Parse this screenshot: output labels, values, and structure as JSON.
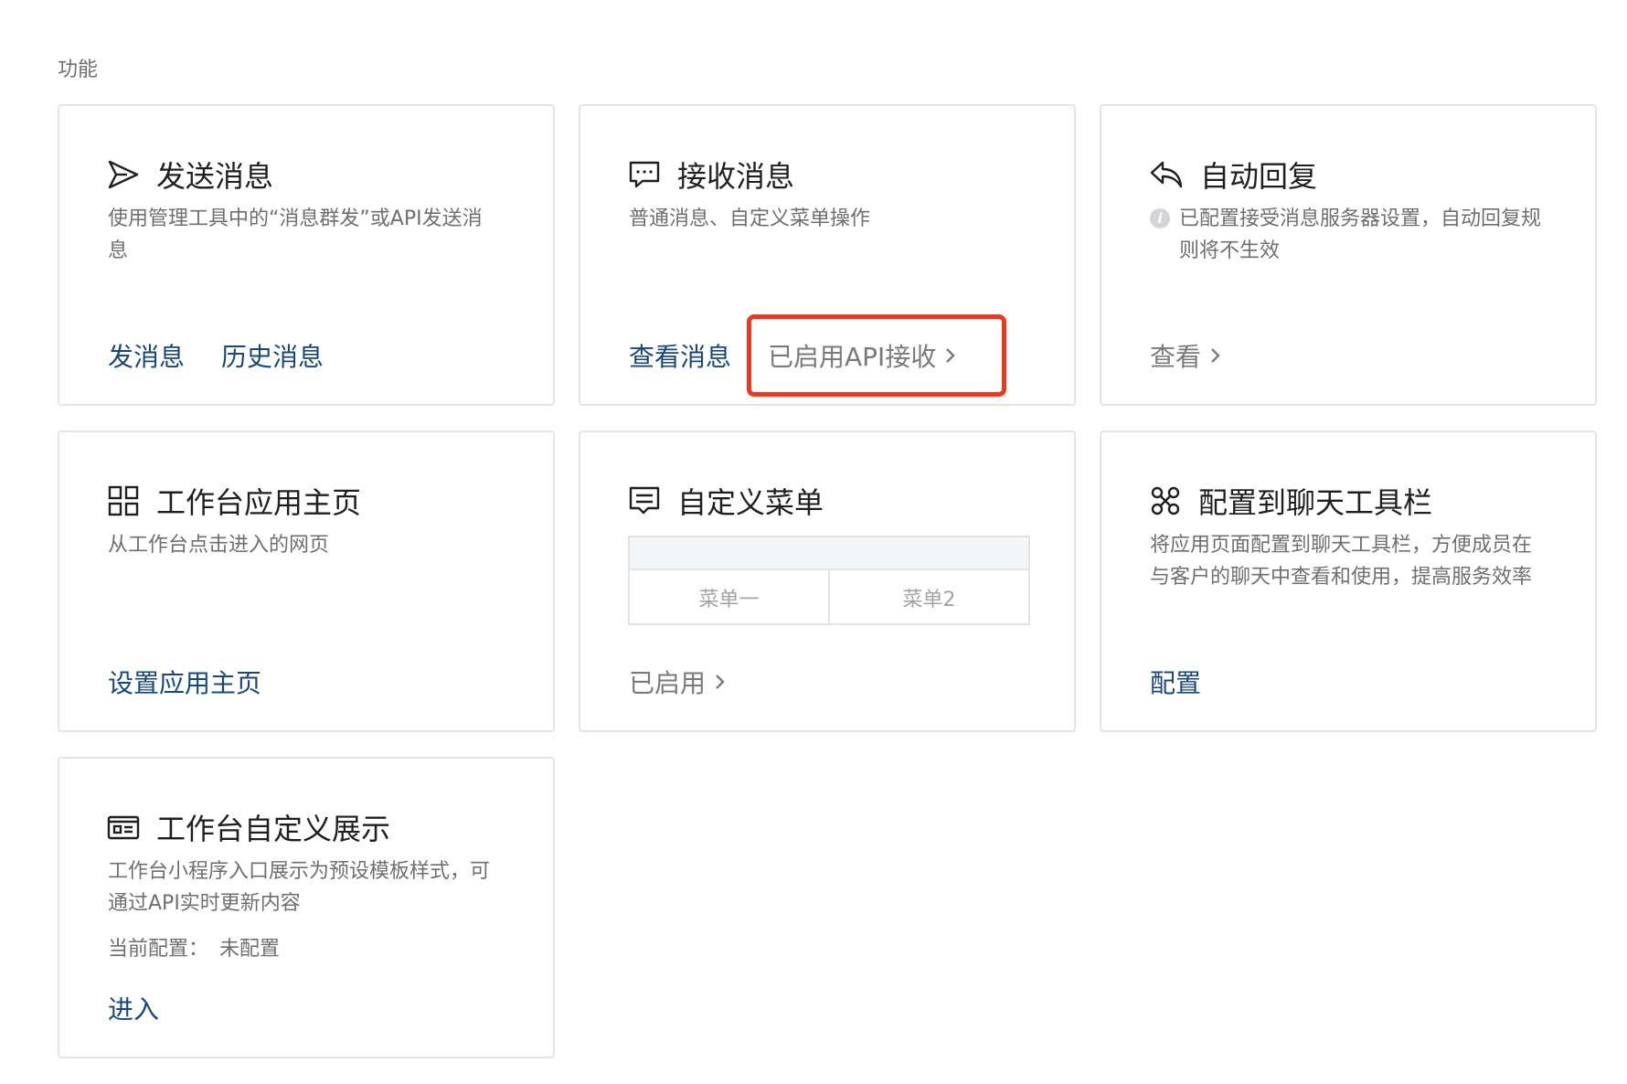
{
  "section_title": "功能",
  "cards": {
    "send_message": {
      "title": "发送消息",
      "icon": "send-icon",
      "desc": "使用管理工具中的“消息群发”或API发送消息",
      "links": [
        "发消息",
        "历史消息"
      ]
    },
    "receive_message": {
      "title": "接收消息",
      "icon": "chat-bubble-icon",
      "desc": "普通消息、自定义菜单操作",
      "link": "查看消息",
      "status_link": "已启用API接收"
    },
    "auto_reply": {
      "title": "自动回复",
      "icon": "reply-icon",
      "desc": "已配置接受消息服务器设置，自动回复规则将不生效",
      "info_icon_char": "i",
      "link": "查看"
    },
    "workbench_home": {
      "title": "工作台应用主页",
      "icon": "grid-icon",
      "desc": "从工作台点击进入的网页",
      "link": "设置应用主页"
    },
    "custom_menu": {
      "title": "自定义菜单",
      "icon": "menu-icon",
      "menu_items": [
        "菜单一",
        "菜单2"
      ],
      "link": "已启用"
    },
    "chat_toolbar": {
      "title": "配置到聊天工具栏",
      "icon": "toolbar-icon",
      "desc": "将应用页面配置到聊天工具栏，方便成员在与客户的聊天中查看和使用，提高服务效率",
      "link": "配置"
    },
    "workbench_display": {
      "title": "工作台自定义展示",
      "icon": "display-card-icon",
      "desc": "工作台小程序入口展示为预设模板样式，可通过API实时更新内容",
      "config_label": "当前配置：",
      "config_value": "未配置",
      "link": "进入"
    }
  },
  "colors": {
    "link": "#17477e",
    "muted": "#6f6f6f",
    "border": "#e3e5e8",
    "highlight": "#e83a23"
  }
}
